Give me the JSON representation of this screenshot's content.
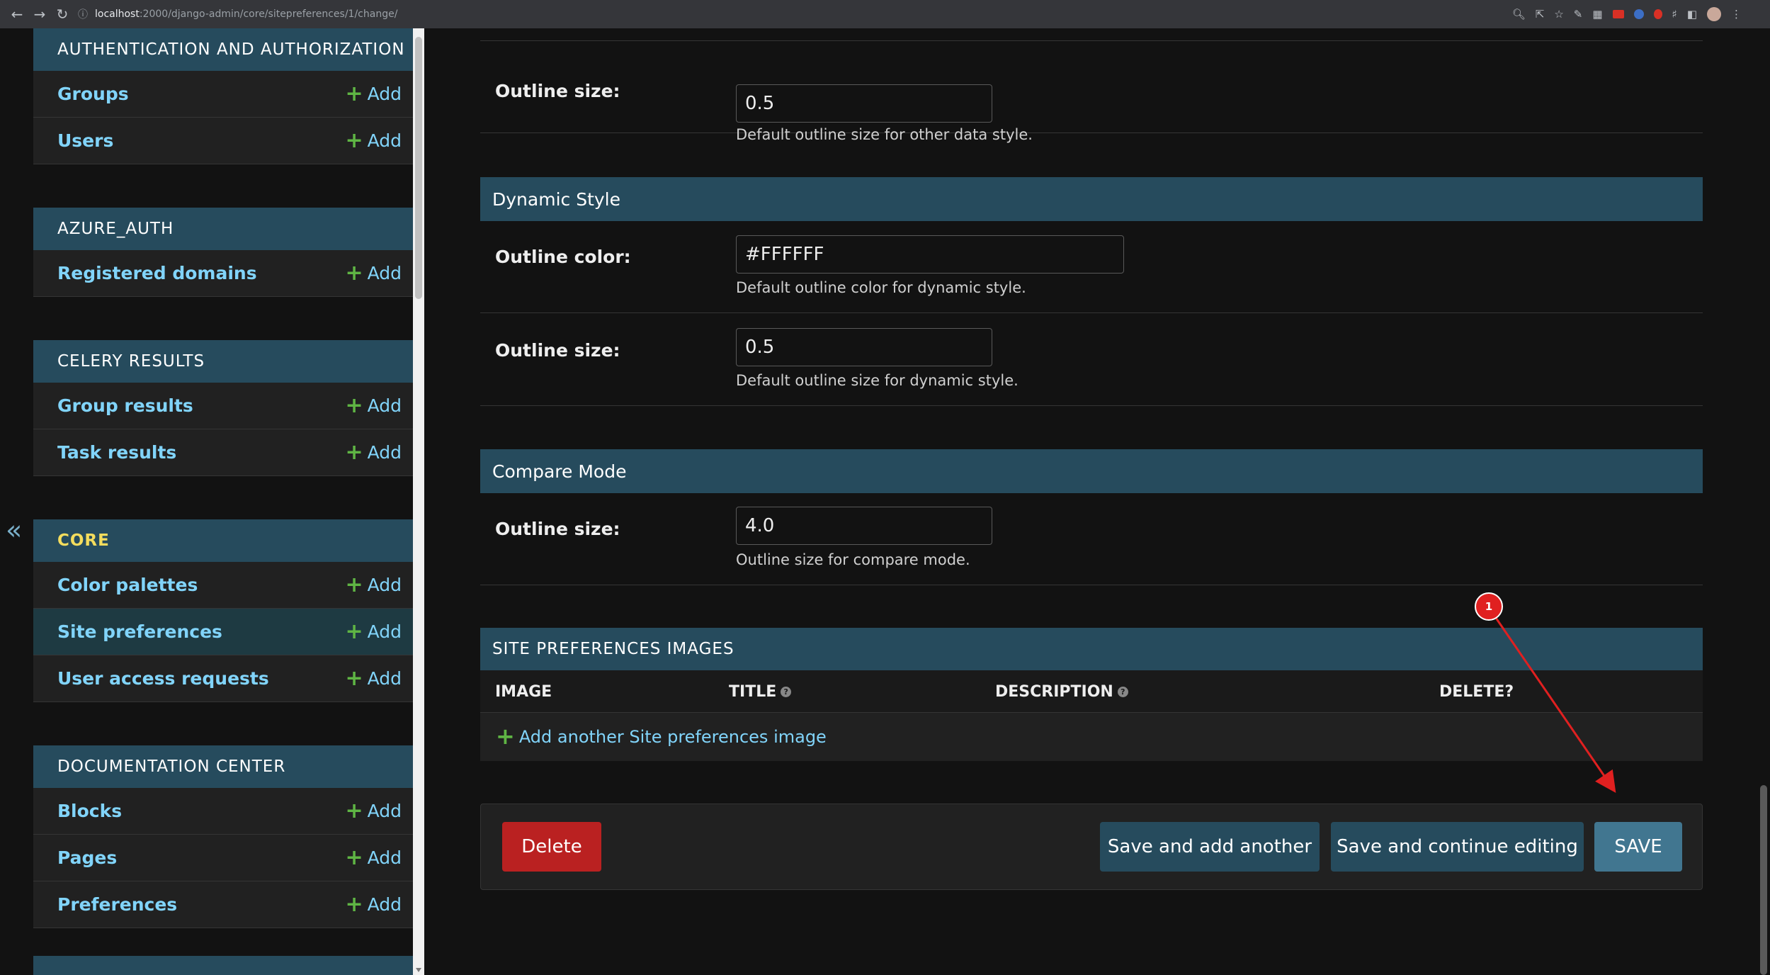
{
  "browser": {
    "url_host": "localhost",
    "url_path": ":2000/django-admin/core/sitepreferences/1/change/"
  },
  "sidebar": {
    "modules": [
      {
        "caption": "AUTHENTICATION AND AUTHORIZATION",
        "rows": [
          {
            "label": "Groups",
            "add": "Add"
          },
          {
            "label": "Users",
            "add": "Add"
          }
        ]
      },
      {
        "caption": "AZURE_AUTH",
        "rows": [
          {
            "label": "Registered domains",
            "add": "Add"
          }
        ]
      },
      {
        "caption": "CELERY RESULTS",
        "rows": [
          {
            "label": "Group results",
            "add": "Add"
          },
          {
            "label": "Task results",
            "add": "Add"
          }
        ]
      },
      {
        "caption": "CORE",
        "rows": [
          {
            "label": "Color palettes",
            "add": "Add"
          },
          {
            "label": "Site preferences",
            "add": "Add"
          },
          {
            "label": "User access requests",
            "add": "Add"
          }
        ]
      },
      {
        "caption": "DOCUMENTATION CENTER",
        "rows": [
          {
            "label": "Blocks",
            "add": "Add"
          },
          {
            "label": "Pages",
            "add": "Add"
          },
          {
            "label": "Preferences",
            "add": "Add"
          }
        ]
      }
    ]
  },
  "form": {
    "other_data_style": {
      "outline_size_label": "Outline size:",
      "outline_size_value": "0.5",
      "outline_size_help": "Default outline size for other data style."
    },
    "dynamic_style": {
      "heading": "Dynamic Style",
      "outline_color_label": "Outline color:",
      "outline_color_value": "#FFFFFF",
      "outline_color_help": "Default outline color for dynamic style.",
      "outline_size_label": "Outline size:",
      "outline_size_value": "0.5",
      "outline_size_help": "Default outline size for dynamic style."
    },
    "compare_mode": {
      "heading": "Compare Mode",
      "outline_size_label": "Outline size:",
      "outline_size_value": "4.0",
      "outline_size_help": "Outline size for compare mode."
    }
  },
  "inline": {
    "caption": "SITE PREFERENCES IMAGES",
    "columns": {
      "image": "IMAGE",
      "title": "TITLE",
      "description": "DESCRIPTION",
      "delete": "DELETE?"
    },
    "help_glyph": "?",
    "add_another": "Add another Site preferences image"
  },
  "submit": {
    "delete": "Delete",
    "save_add_another": "Save and add another",
    "save_continue": "Save and continue editing",
    "save": "SAVE"
  },
  "annotation": {
    "badge": "1",
    "color": "#e02020"
  },
  "colors": {
    "header": "#264b5d",
    "link": "#81d4fa",
    "add_plus": "#5fb544",
    "delete": "#ba2121",
    "save": "#417690"
  }
}
